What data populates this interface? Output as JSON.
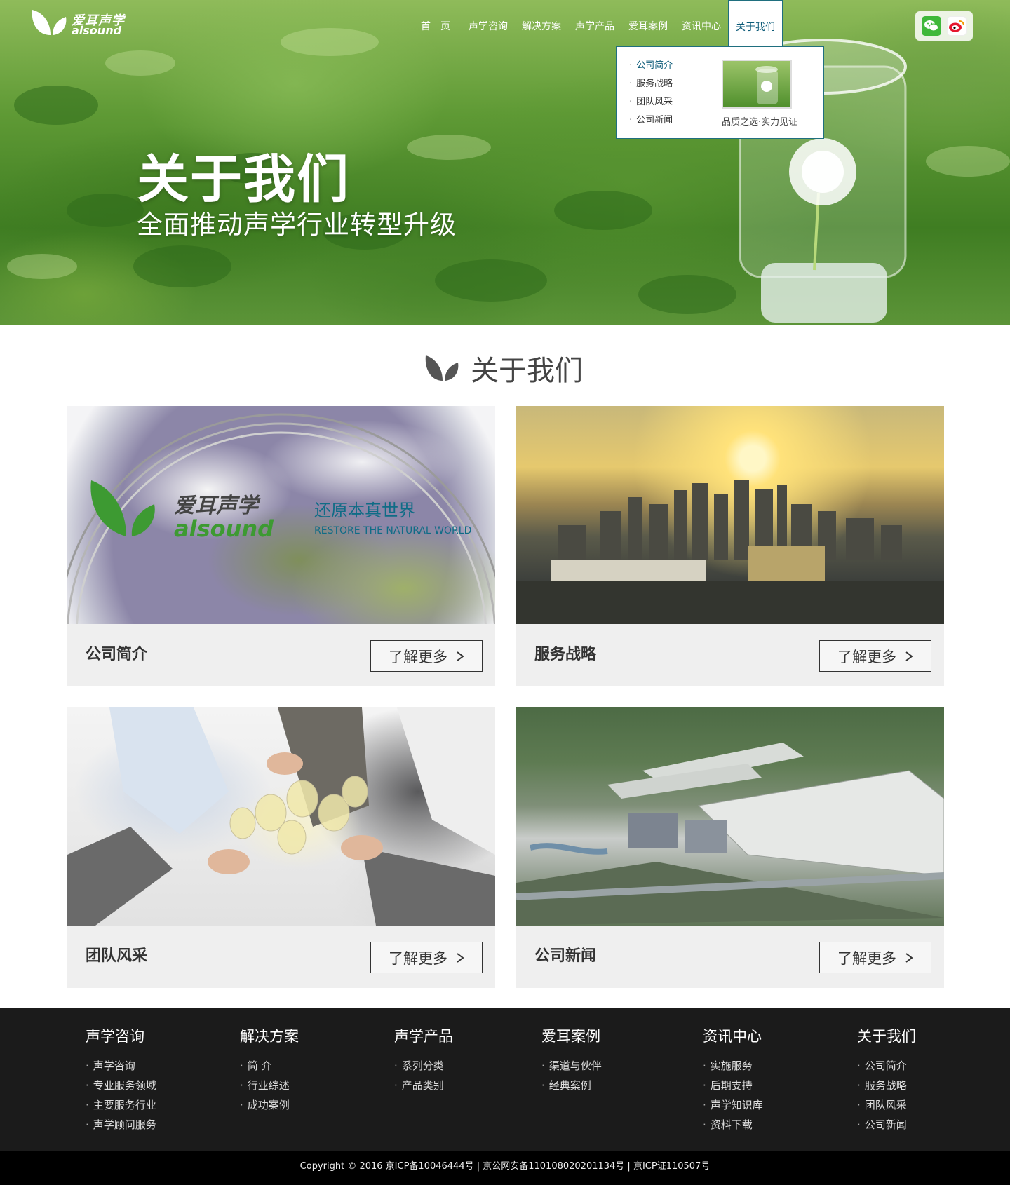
{
  "header": {
    "logo": {
      "cn": "爱耳声学",
      "en": "alsound"
    },
    "nav": [
      {
        "label": "首页"
      },
      {
        "label": "声学咨询"
      },
      {
        "label": "解决方案"
      },
      {
        "label": "声学产品"
      },
      {
        "label": "爱耳案例"
      },
      {
        "label": "资讯中心"
      },
      {
        "label": "关于我们",
        "active": true
      }
    ],
    "dropdown": {
      "items": [
        "公司简介",
        "服务战略",
        "团队风采",
        "公司新闻"
      ],
      "selected": "公司简介",
      "caption": "品质之选·实力见证"
    },
    "social": [
      "wechat-icon",
      "weibo-icon"
    ]
  },
  "hero": {
    "title": "关于我们",
    "subtitle": "全面推动声学行业转型升级"
  },
  "section": {
    "title": "关于我们"
  },
  "globe_text": {
    "cn": "爱耳声学",
    "en": "alsound",
    "slogan_cn": "还原本真世界",
    "slogan_en": "RESTORE THE NATURAL WORLD"
  },
  "cards": [
    {
      "label": "公司简介",
      "more": "了解更多"
    },
    {
      "label": "服务战略",
      "more": "了解更多"
    },
    {
      "label": "团队风采",
      "more": "了解更多"
    },
    {
      "label": "公司新闻",
      "more": "了解更多"
    }
  ],
  "footer": {
    "columns": [
      {
        "title": "声学咨询",
        "items": [
          "声学咨询",
          "专业服务领域",
          "主要服务行业",
          "声学顾问服务"
        ]
      },
      {
        "title": "解决方案",
        "items": [
          "简 介",
          "行业综述",
          "成功案例"
        ]
      },
      {
        "title": "声学产品",
        "items": [
          "系列分类",
          "产品类别"
        ]
      },
      {
        "title": "爱耳案例",
        "items": [
          "渠道与伙伴",
          "经典案例"
        ]
      },
      {
        "title": "资讯中心",
        "items": [
          "实施服务",
          "后期支持",
          "声学知识库",
          "资料下载"
        ]
      },
      {
        "title": "关于我们",
        "items": [
          "公司简介",
          "服务战略",
          "团队风采",
          "公司新闻"
        ]
      }
    ],
    "copyright": "Copyright © 2016  京ICP备10046444号 | 京公网安备110108020201134号 | 京ICP证110507号"
  },
  "colors": {
    "accent": "#0b5a78",
    "footer_bg": "#1b1b1b",
    "card_bg": "#efefef",
    "brand_green": "#3d9a32"
  }
}
